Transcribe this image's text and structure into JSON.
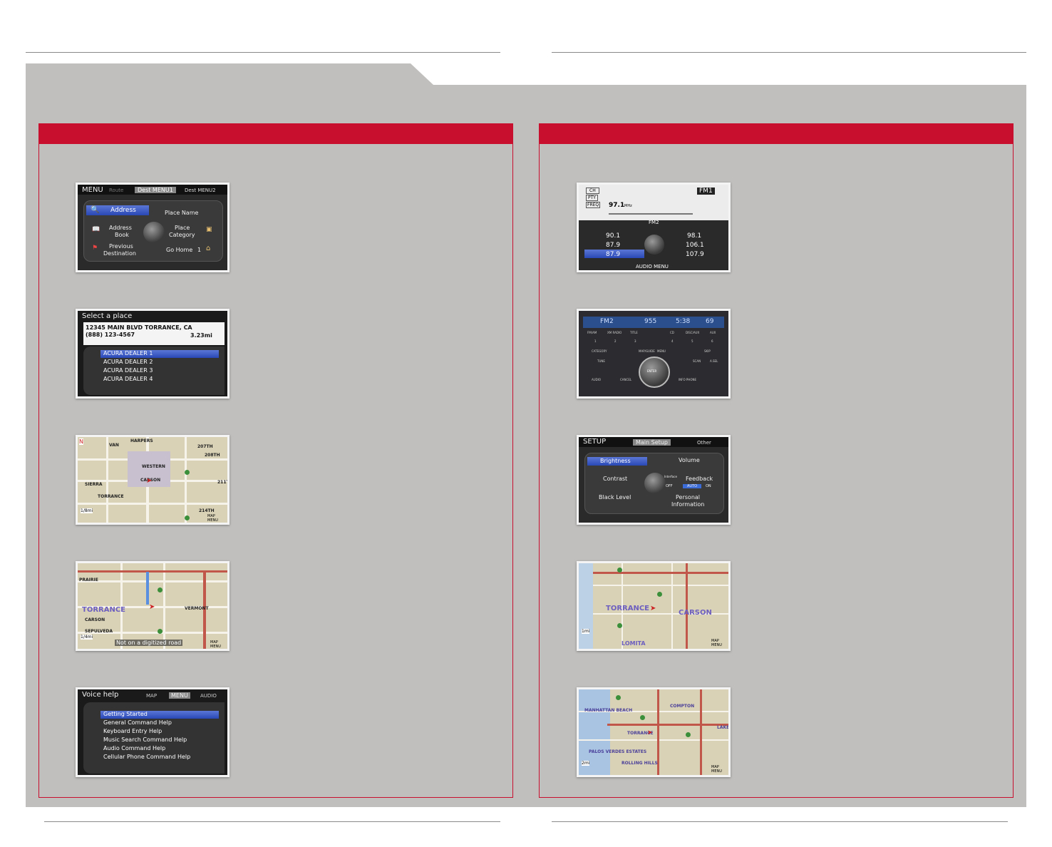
{
  "screens": {
    "dest_menu": {
      "menu": "MENU",
      "prev_tab": "Route",
      "active_tab": "Dest MENU1",
      "next_tab": "Dest MENU2",
      "address": "Address",
      "place_name": "Place Name",
      "address_book_1": "Address",
      "address_book_2": "Book",
      "place_category_1": "Place",
      "place_category_2": "Category",
      "previous_dest_1": "Previous",
      "previous_dest_2": "Destination",
      "go_home": "Go Home",
      "go_home_num": "1"
    },
    "select_place": {
      "title": "Select a place",
      "address_line": "12345 MAIN BLVD TORRANCE, CA",
      "phone": "(888) 123-4567",
      "distance": "3.23mi",
      "results": [
        "ACURA DEALER 1",
        "ACURA DEALER 2",
        "ACURA DEALER 3",
        "ACURA DEALER 4"
      ]
    },
    "map_street": {
      "labels": [
        "HARPERS",
        "207TH",
        "208TH",
        "SIERRA",
        "TORRANCE",
        "211T",
        "214TH",
        "VAN",
        "WESTERN",
        "CARSON"
      ],
      "scale": "1/8mi",
      "map_menu": "MAP MENU"
    },
    "map_route": {
      "labels": [
        "TORRANCE",
        "CARSON",
        "SEPULVEDA",
        "VERMONT",
        "PRAIRIE"
      ],
      "status": "Not on a digitized road",
      "scale": "1/4mi",
      "map_menu": "MAP MENU"
    },
    "voice_help": {
      "title": "Voice help",
      "tab_map": "MAP",
      "tab_menu": "MENU",
      "tab_audio": "AUDIO",
      "items": [
        "Getting Started",
        "General Command Help",
        "Keyboard Entry Help",
        "Music Search Command Help",
        "Audio Command Help",
        "Cellular Phone Command Help"
      ]
    },
    "radio": {
      "ch": "CH",
      "pty": "PTY",
      "freq_label": "FREQ",
      "freq": "97.1",
      "freq_unit": "MHz",
      "band": "FM1",
      "band2": "FM2",
      "presets_left": [
        "90.1",
        "87.9",
        "87.9"
      ],
      "presets_right": [
        "98.1",
        "106.1",
        "107.9"
      ],
      "audio_menu": "AUDIO MENU"
    },
    "console": {
      "band": "FM2",
      "freq": "955",
      "clock": "5:38",
      "temp": "69",
      "buttons_top": [
        "FM/AM",
        "XM RADIO",
        "TITLE",
        "CD",
        "DISC/AUX",
        "AUX"
      ],
      "presets": [
        "1",
        "2",
        "3",
        "4",
        "5",
        "6"
      ],
      "category": "CATEGORY",
      "skip": "SKIP",
      "tune": "TUNE",
      "scan": "SCAN",
      "a_sel": "A.SEL",
      "map_guide": "MAP/GUIDE",
      "menu": "MENU",
      "enter": "ENTER",
      "audio": "AUDIO",
      "cancel": "CANCEL",
      "info_phone": "INFO PHONE"
    },
    "setup": {
      "title": "SETUP",
      "active_tab": "Main Setup",
      "other": "Other",
      "brightness": "Brightness",
      "volume": "Volume",
      "contrast": "Contrast",
      "interface": "Interface",
      "feedback": "Feedback",
      "black_level": "Black Level",
      "personal_1": "Personal",
      "personal_2": "Information",
      "off": "OFF",
      "auto": "AUTO",
      "on": "ON"
    },
    "map_area": {
      "labels": [
        "TORRANCE",
        "CARSON",
        "LOMITA"
      ],
      "scale": "1mi",
      "map_menu": "MAP MENU"
    },
    "map_coast": {
      "labels": [
        "MANHATTAN BEACH",
        "COMPTON",
        "TORRANCE",
        "PALOS VERDES ESTATES",
        "ROLLING HILLS",
        "LAKE"
      ],
      "scale": "2mi",
      "map_menu": "MAP MENU"
    }
  }
}
